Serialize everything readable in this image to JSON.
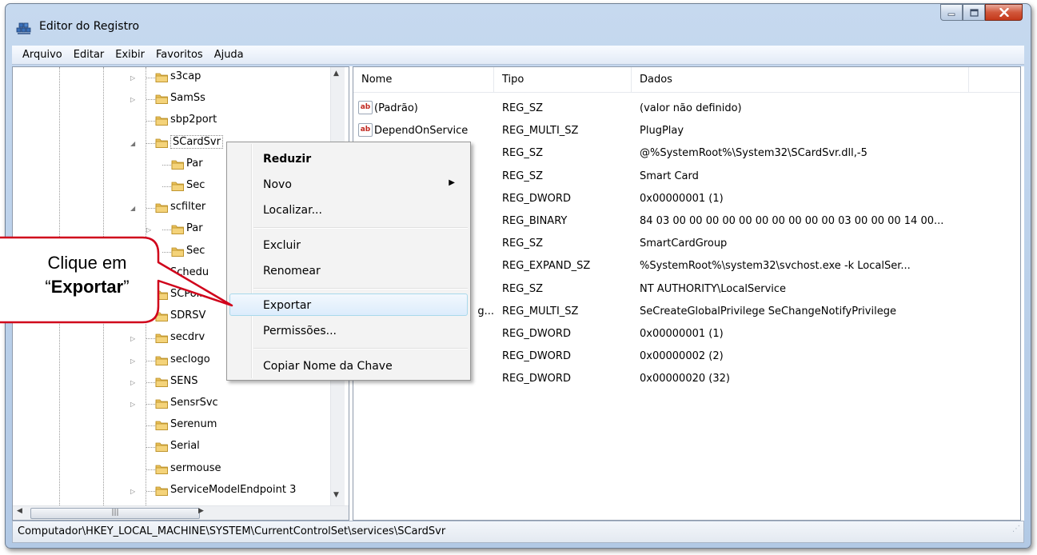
{
  "window": {
    "title": "Editor do Registro"
  },
  "menubar": {
    "items": [
      "Arquivo",
      "Editar",
      "Exibir",
      "Favoritos",
      "Ajuda"
    ]
  },
  "tree": {
    "items": [
      {
        "label": "s3cap",
        "level": 0,
        "expander": "collapsed"
      },
      {
        "label": "SamSs",
        "level": 0,
        "expander": "collapsed"
      },
      {
        "label": "sbp2port",
        "level": 0,
        "expander": "none"
      },
      {
        "label": "SCardSvr",
        "level": 0,
        "expander": "expanded",
        "selected": true
      },
      {
        "label": "Par",
        "level": 1,
        "expander": "none"
      },
      {
        "label": "Sec",
        "level": 1,
        "expander": "none"
      },
      {
        "label": "scfilter",
        "level": 0,
        "expander": "expanded"
      },
      {
        "label": "Par",
        "level": 1,
        "expander": "collapsed"
      },
      {
        "label": "Sec",
        "level": 1,
        "expander": "none"
      },
      {
        "label": "Schedu",
        "level": 0,
        "expander": "none"
      },
      {
        "label": "SCPolic",
        "level": 0,
        "expander": "none"
      },
      {
        "label": "SDRSV",
        "level": 0,
        "expander": "none"
      },
      {
        "label": "secdrv",
        "level": 0,
        "expander": "collapsed"
      },
      {
        "label": "seclogo",
        "level": 0,
        "expander": "collapsed"
      },
      {
        "label": "SENS",
        "level": 0,
        "expander": "collapsed"
      },
      {
        "label": "SensrSvc",
        "level": 0,
        "expander": "collapsed"
      },
      {
        "label": "Serenum",
        "level": 0,
        "expander": "none"
      },
      {
        "label": "Serial",
        "level": 0,
        "expander": "none"
      },
      {
        "label": "sermouse",
        "level": 0,
        "expander": "none"
      },
      {
        "label": "ServiceModelEndpoint 3",
        "level": 0,
        "expander": "collapsed"
      }
    ]
  },
  "values": {
    "headers": {
      "name": "Nome",
      "type": "Tipo",
      "data": "Dados"
    },
    "rows": [
      {
        "name": "(Padrão)",
        "type": "REG_SZ",
        "data": "(valor não definido)",
        "icon": "string-value-icon"
      },
      {
        "name": "DependOnService",
        "type": "REG_MULTI_SZ",
        "data": "PlugPlay",
        "icon": "string-value-icon"
      },
      {
        "name": "",
        "type": "REG_SZ",
        "data": "@%SystemRoot%\\System32\\SCardSvr.dll,-5",
        "icon": ""
      },
      {
        "name": "",
        "type": "REG_SZ",
        "data": "Smart Card",
        "icon": ""
      },
      {
        "name": "",
        "type": "REG_DWORD",
        "data": "0x00000001 (1)",
        "icon": ""
      },
      {
        "name": "",
        "type": "REG_BINARY",
        "data": "84 03 00 00 00 00 00 00 00 00 00 00 03 00 00 00 14 00...",
        "icon": ""
      },
      {
        "name": "",
        "type": "REG_SZ",
        "data": "SmartCardGroup",
        "icon": ""
      },
      {
        "name": "",
        "type": "REG_EXPAND_SZ",
        "data": "%SystemRoot%\\system32\\svchost.exe -k LocalSer...",
        "icon": ""
      },
      {
        "name": "",
        "type": "REG_SZ",
        "data": "NT AUTHORITY\\LocalService",
        "icon": ""
      },
      {
        "name": "g...",
        "type": "REG_MULTI_SZ",
        "data": "SeCreateGlobalPrivilege SeChangeNotifyPrivilege",
        "icon": ""
      },
      {
        "name": "",
        "type": "REG_DWORD",
        "data": "0x00000001 (1)",
        "icon": ""
      },
      {
        "name": "",
        "type": "REG_DWORD",
        "data": "0x00000002 (2)",
        "icon": ""
      },
      {
        "name": "",
        "type": "REG_DWORD",
        "data": "0x00000020 (32)",
        "icon": ""
      }
    ]
  },
  "context_menu": {
    "items": [
      {
        "label": "Reduzir",
        "bold": true
      },
      {
        "label": "Novo",
        "submenu": true
      },
      {
        "label": "Localizar..."
      },
      {
        "label": "Excluir"
      },
      {
        "label": "Renomear"
      },
      {
        "label": "Exportar",
        "highlighted": true
      },
      {
        "label": "Permissões..."
      },
      {
        "label": "Copiar Nome da Chave"
      }
    ]
  },
  "statusbar": {
    "path": "Computador\\HKEY_LOCAL_MACHINE\\SYSTEM\\CurrentControlSet\\services\\SCardSvr"
  },
  "callout": {
    "line1": "Clique em",
    "quote_open": "“",
    "bold_word": "Exportar",
    "quote_close": "”"
  },
  "colors": {
    "callout_border": "#d0021b",
    "menu_highlight": "#dcecfc",
    "title_bar": "#c6d9ef"
  }
}
